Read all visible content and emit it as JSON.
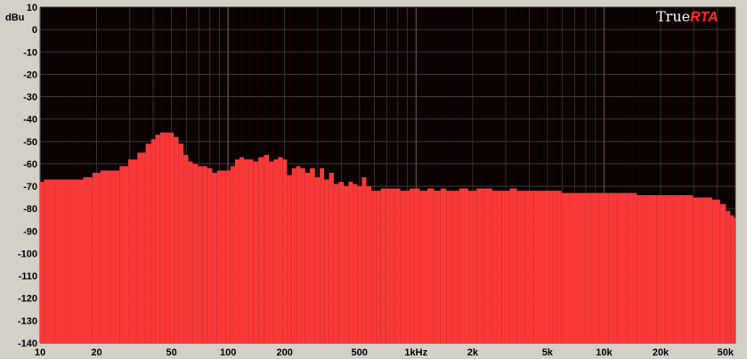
{
  "logo": {
    "part1": "True",
    "part2": "RTA"
  },
  "colors": {
    "background": "#d4d0c8",
    "plot": "#000000",
    "bars": "#ff3b3b",
    "grid": "#3a3a3a",
    "grid_major": "#5a5a5a"
  },
  "chart_data": {
    "type": "bar",
    "ylabel": "dBu",
    "xscale": "log",
    "xlim": [
      10,
      50000
    ],
    "ylim": [
      -140,
      10
    ],
    "grid": true,
    "yticks": [
      10,
      0,
      -10,
      -20,
      -30,
      -40,
      -50,
      -60,
      -70,
      -80,
      -90,
      -100,
      -110,
      -120,
      -130,
      -140
    ],
    "xticks": [
      {
        "value": 10,
        "label": "10"
      },
      {
        "value": 20,
        "label": "20"
      },
      {
        "value": 50,
        "label": "50"
      },
      {
        "value": 100,
        "label": "100"
      },
      {
        "value": 200,
        "label": "200"
      },
      {
        "value": 500,
        "label": "500"
      },
      {
        "value": 1000,
        "label": "1kHz"
      },
      {
        "value": 2000,
        "label": "2k"
      },
      {
        "value": 5000,
        "label": "5k"
      },
      {
        "value": 10000,
        "label": "10k"
      },
      {
        "value": 20000,
        "label": "20k"
      },
      {
        "value": 50000,
        "label": "50k"
      }
    ],
    "spectrum": [
      [
        10,
        -68
      ],
      [
        11,
        -67
      ],
      [
        13,
        -67
      ],
      [
        16,
        -67
      ],
      [
        18,
        -66
      ],
      [
        20,
        -64
      ],
      [
        22,
        -63
      ],
      [
        25,
        -63
      ],
      [
        28,
        -61
      ],
      [
        31,
        -58
      ],
      [
        35,
        -55
      ],
      [
        38,
        -51
      ],
      [
        40,
        -49
      ],
      [
        42,
        -47
      ],
      [
        45,
        -46
      ],
      [
        48,
        -46
      ],
      [
        50,
        -46
      ],
      [
        53,
        -48
      ],
      [
        56,
        -51
      ],
      [
        60,
        -56
      ],
      [
        63,
        -59
      ],
      [
        67,
        -60
      ],
      [
        71,
        -61
      ],
      [
        75,
        -61
      ],
      [
        80,
        -62
      ],
      [
        85,
        -64
      ],
      [
        90,
        -63
      ],
      [
        95,
        -63
      ],
      [
        100,
        -63
      ],
      [
        106,
        -61
      ],
      [
        112,
        -58
      ],
      [
        118,
        -57
      ],
      [
        125,
        -58
      ],
      [
        132,
        -58
      ],
      [
        140,
        -59
      ],
      [
        150,
        -57
      ],
      [
        160,
        -56
      ],
      [
        170,
        -59
      ],
      [
        180,
        -58
      ],
      [
        190,
        -57
      ],
      [
        200,
        -58
      ],
      [
        212,
        -65
      ],
      [
        225,
        -62
      ],
      [
        236,
        -61
      ],
      [
        250,
        -62
      ],
      [
        265,
        -64
      ],
      [
        280,
        -62
      ],
      [
        300,
        -66
      ],
      [
        315,
        -62
      ],
      [
        335,
        -67
      ],
      [
        355,
        -64
      ],
      [
        375,
        -69
      ],
      [
        400,
        -68
      ],
      [
        425,
        -70
      ],
      [
        450,
        -68
      ],
      [
        475,
        -69
      ],
      [
        500,
        -70
      ],
      [
        530,
        -66
      ],
      [
        560,
        -70
      ],
      [
        600,
        -72
      ],
      [
        630,
        -72
      ],
      [
        670,
        -71
      ],
      [
        710,
        -71
      ],
      [
        750,
        -71
      ],
      [
        800,
        -71
      ],
      [
        850,
        -72
      ],
      [
        900,
        -72
      ],
      [
        950,
        -71
      ],
      [
        1000,
        -71
      ],
      [
        1100,
        -72
      ],
      [
        1200,
        -71
      ],
      [
        1300,
        -72
      ],
      [
        1400,
        -71
      ],
      [
        1500,
        -72
      ],
      [
        1600,
        -72
      ],
      [
        1800,
        -71
      ],
      [
        2000,
        -72
      ],
      [
        2200,
        -71
      ],
      [
        2400,
        -71
      ],
      [
        2700,
        -72
      ],
      [
        3000,
        -72
      ],
      [
        3300,
        -71
      ],
      [
        3600,
        -72
      ],
      [
        4000,
        -72
      ],
      [
        4500,
        -72
      ],
      [
        5000,
        -72
      ],
      [
        5600,
        -72
      ],
      [
        6300,
        -73
      ],
      [
        7100,
        -73
      ],
      [
        8000,
        -73
      ],
      [
        9000,
        -73
      ],
      [
        10000,
        -73
      ],
      [
        11200,
        -73
      ],
      [
        12500,
        -73
      ],
      [
        14000,
        -73
      ],
      [
        16000,
        -74
      ],
      [
        18000,
        -74
      ],
      [
        20000,
        -74
      ],
      [
        22400,
        -74
      ],
      [
        25000,
        -74
      ],
      [
        28000,
        -74
      ],
      [
        31500,
        -75
      ],
      [
        35500,
        -75
      ],
      [
        40000,
        -76
      ],
      [
        43000,
        -78
      ],
      [
        46000,
        -81
      ],
      [
        48000,
        -83
      ],
      [
        50000,
        -84
      ]
    ]
  }
}
